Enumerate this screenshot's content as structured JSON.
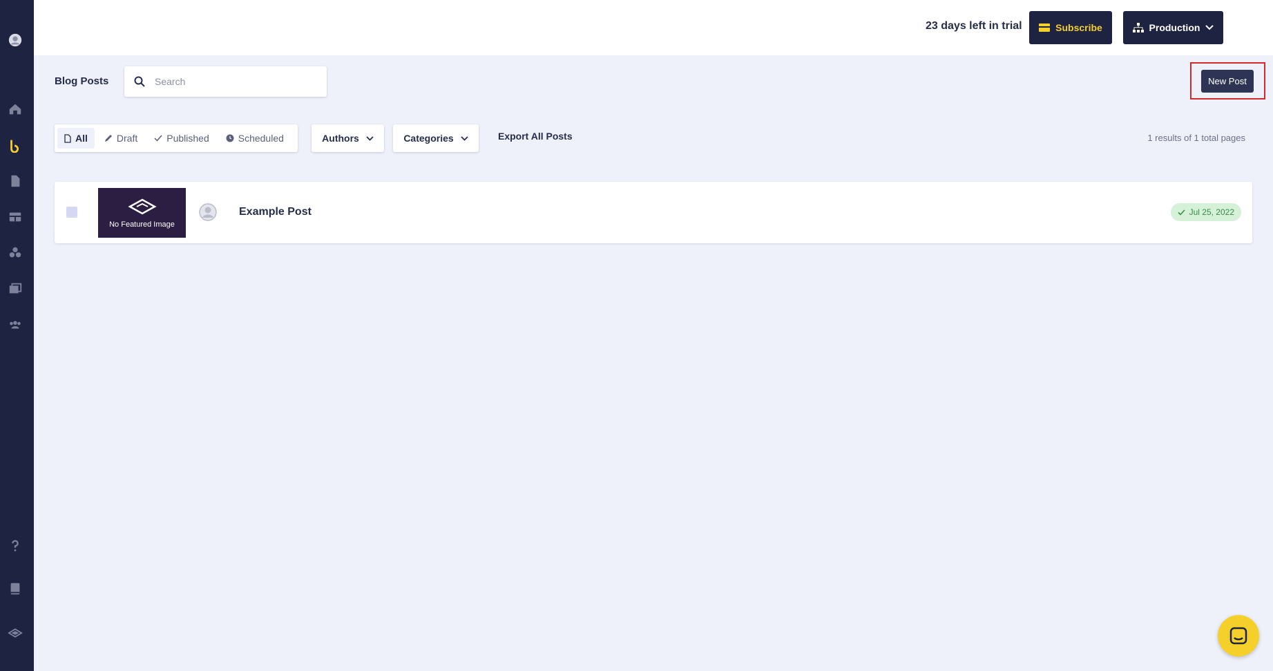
{
  "topbar": {
    "trial_text": "23 days left in trial",
    "subscribe_label": "Subscribe",
    "environment_label": "Production"
  },
  "header": {
    "title": "Blog Posts",
    "search_placeholder": "Search",
    "new_post_label": "New Post"
  },
  "filters": {
    "tabs": [
      "All",
      "Draft",
      "Published",
      "Scheduled"
    ],
    "active_tab": "All",
    "authors_label": "Authors",
    "categories_label": "Categories",
    "export_label": "Export All Posts",
    "results_text": "1 results of 1 total pages"
  },
  "posts": [
    {
      "title": "Example Post",
      "thumbnail_text": "No Featured Image",
      "date": "Jul 25, 2022",
      "status": "published"
    }
  ],
  "sidebar": {
    "icons": [
      "user-avatar-icon",
      "home-icon",
      "blog-icon",
      "pages-icon",
      "table-icon",
      "components-icon",
      "media-icon",
      "team-icon",
      "help-icon",
      "docs-icon",
      "layers-icon"
    ]
  },
  "colors": {
    "sidebar": "#1d2340",
    "accent_yellow": "#f5cf2a",
    "page_bg": "#eef0fa",
    "highlight": "#d62828"
  }
}
